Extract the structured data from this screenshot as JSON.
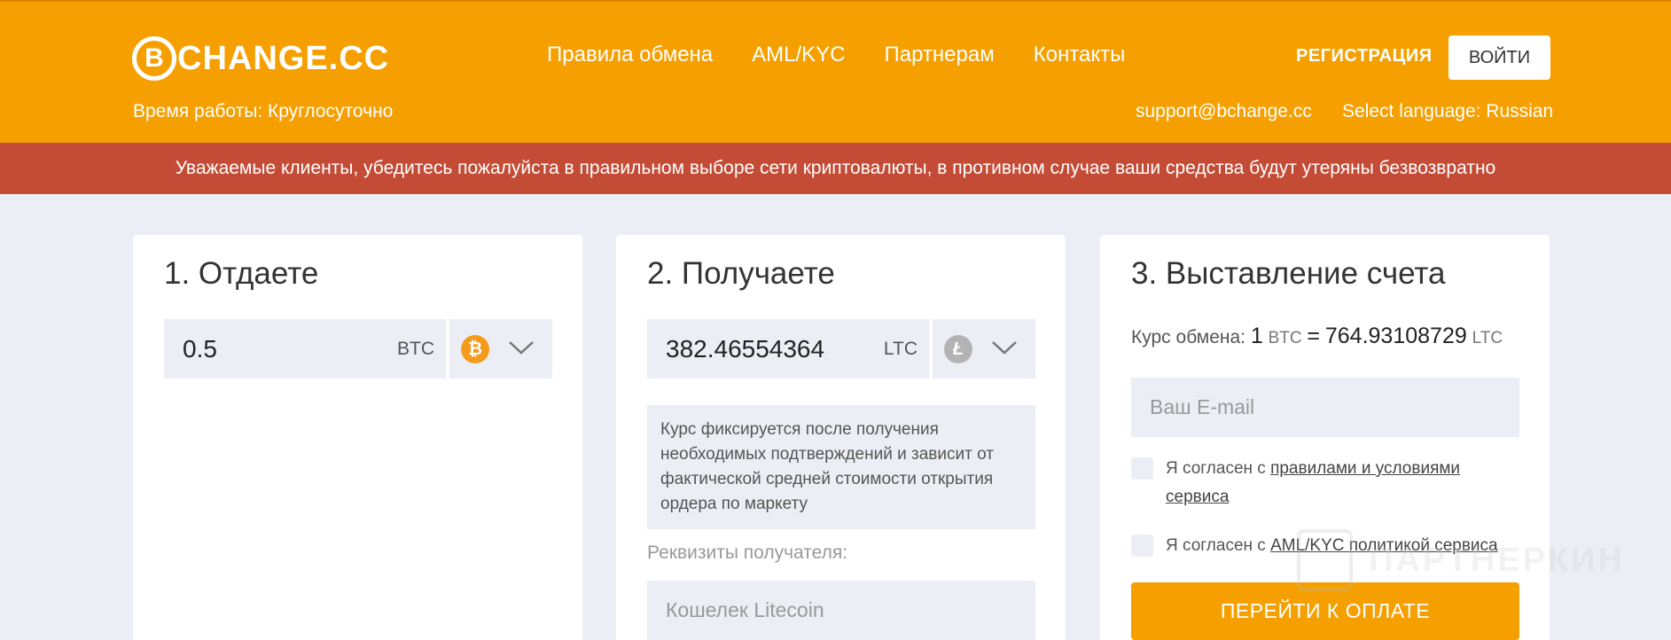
{
  "header": {
    "logo_letter": "B",
    "logo_text": "CHANGE.CC",
    "nav": [
      "Правила обмена",
      "AML/KYC",
      "Партнерам",
      "Контакты"
    ],
    "register_label": "РЕГИСТРАЦИЯ",
    "login_label": "ВОЙТИ",
    "hours": "Время работы: Круглосуточно",
    "support_email": "support@bchange.cc",
    "language": "Select language: Russian"
  },
  "alert": "Уважаемые клиенты, убедитесь пожалуйста в правильном выборе сети криптовалюты, в противном случае ваши средства будут утеряны безвозвратно",
  "give": {
    "title": "1. Отдаете",
    "amount": "0.5",
    "currency": "BTC",
    "coin_icon": "bitcoin-icon",
    "coin_glyph": "₿"
  },
  "receive": {
    "title": "2. Получаете",
    "amount": "382.46554364",
    "currency": "LTC",
    "coin_icon": "litecoin-icon",
    "coin_glyph": "Ł",
    "note": "Курс фиксируется после получения необходимых подтверждений и зависит от фактической средней стоимости открытия ордера по маркету",
    "requisites_label": "Реквизиты получателя:",
    "wallet_placeholder": "Кошелек Litecoin"
  },
  "invoice": {
    "title": "3. Выставление счета",
    "rate_label": "Курс обмена:",
    "rate_from_amount": "1",
    "rate_from_ccy": "BTC",
    "rate_eq": "=",
    "rate_to_amount": "764.93108729",
    "rate_to_ccy": "LTC",
    "email_placeholder": "Ваш E-mail",
    "agree1_prefix": "Я согласен с",
    "agree1_link": "правилами и условиями сервиса",
    "agree2_prefix": "Я согласен с",
    "agree2_link": "AML/KYC политикой сервиса",
    "pay_button": "ПЕРЕЙТИ К ОПЛАТЕ"
  },
  "watermark": "ПАРТНЕРКИН",
  "colors": {
    "header": "#f5a000",
    "alert": "#c44c36",
    "background": "#eceef5",
    "btc": "#f59b1b",
    "ltc": "#b3b3b3"
  }
}
